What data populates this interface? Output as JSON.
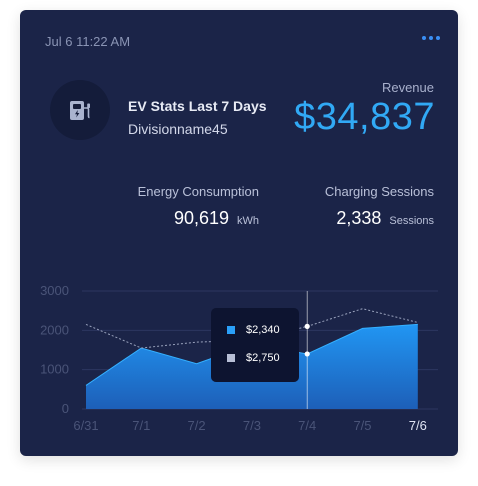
{
  "header": {
    "timestamp": "Jul 6 11:22 AM",
    "menu_icon": "more-horizontal-icon"
  },
  "summary": {
    "icon": "ev-charging-station-icon",
    "title": "EV Stats Last 7 Days",
    "division": "Divisionname45",
    "revenue_label": "Revenue",
    "revenue_value": "$34,837"
  },
  "stats": {
    "energy": {
      "label": "Energy Consumption",
      "value": "90,619",
      "unit": "kWh"
    },
    "sessions": {
      "label": "Charging Sessions",
      "value": "2,338",
      "unit": "Sessions"
    }
  },
  "colors": {
    "background": "#1b2448",
    "accent": "#31a9f5",
    "series_fill_top": "#2196f3",
    "series_fill_bottom": "#1d5fb8",
    "comparison_line": "#9aa3bd"
  },
  "tooltip": {
    "row1_value": "$2,340",
    "row2_value": "$2,750"
  },
  "chart_data": {
    "type": "area",
    "categories": [
      "6/31",
      "7/1",
      "7/2",
      "7/3",
      "7/4",
      "7/5",
      "7/6"
    ],
    "ylim": [
      0,
      3000
    ],
    "yticks": [
      "0",
      "1000",
      "2000",
      "3000"
    ],
    "highlighted_category": "7/6",
    "series": [
      {
        "values": [
          600,
          1550,
          1150,
          1650,
          1400,
          2050,
          2150
        ]
      },
      {
        "values": [
          2150,
          1550,
          1700,
          1750,
          2100,
          2550,
          2200
        ]
      }
    ],
    "grid": true,
    "cursor_category": "7/4"
  }
}
